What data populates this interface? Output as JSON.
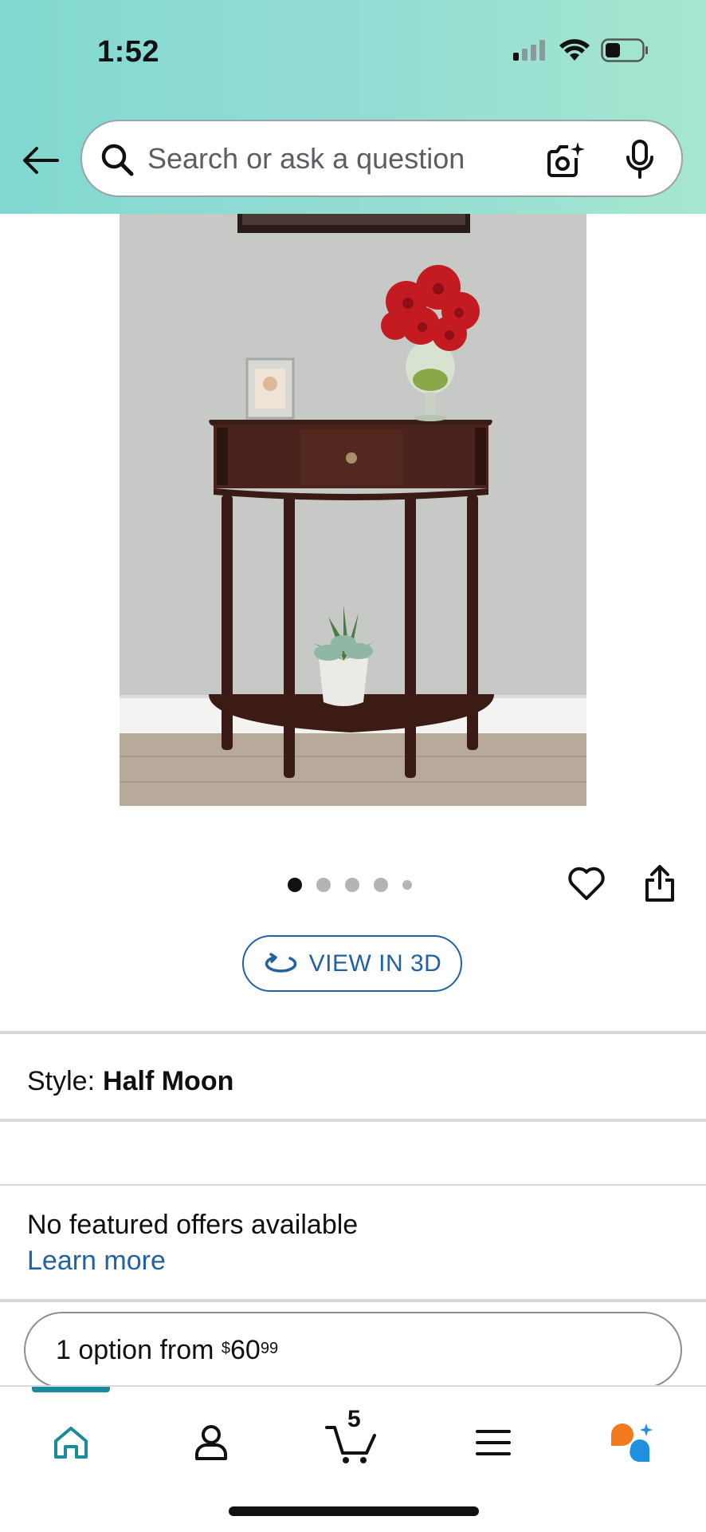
{
  "status_bar": {
    "time": "1:52"
  },
  "search": {
    "placeholder": "Search or ask a question"
  },
  "carousel": {
    "active_index": 0,
    "total": 5
  },
  "view_3d": {
    "label": "VIEW IN 3D"
  },
  "style": {
    "label": "Style:",
    "value": "Half Moon"
  },
  "offers": {
    "message": "No featured offers available",
    "link": "Learn more"
  },
  "option": {
    "prefix": "1 option from ",
    "currency": "$",
    "whole": "60",
    "fraction": "99"
  },
  "nav": {
    "cart_count": "5",
    "active_item": "home"
  },
  "colors": {
    "header_start": "#81d8d0",
    "header_end": "#a5e6cf",
    "link": "#2162a1",
    "nav_accent": "#1b8b9b",
    "assistant_orange": "#f47a20",
    "assistant_blue": "#1f8fe0"
  },
  "icons": [
    "back-arrow-icon",
    "search-icon",
    "camera-sparkle-icon",
    "microphone-icon",
    "heart-icon",
    "share-icon",
    "rotate-3d-icon",
    "home-icon",
    "account-icon",
    "cart-icon",
    "menu-icon",
    "assistant-icon"
  ]
}
